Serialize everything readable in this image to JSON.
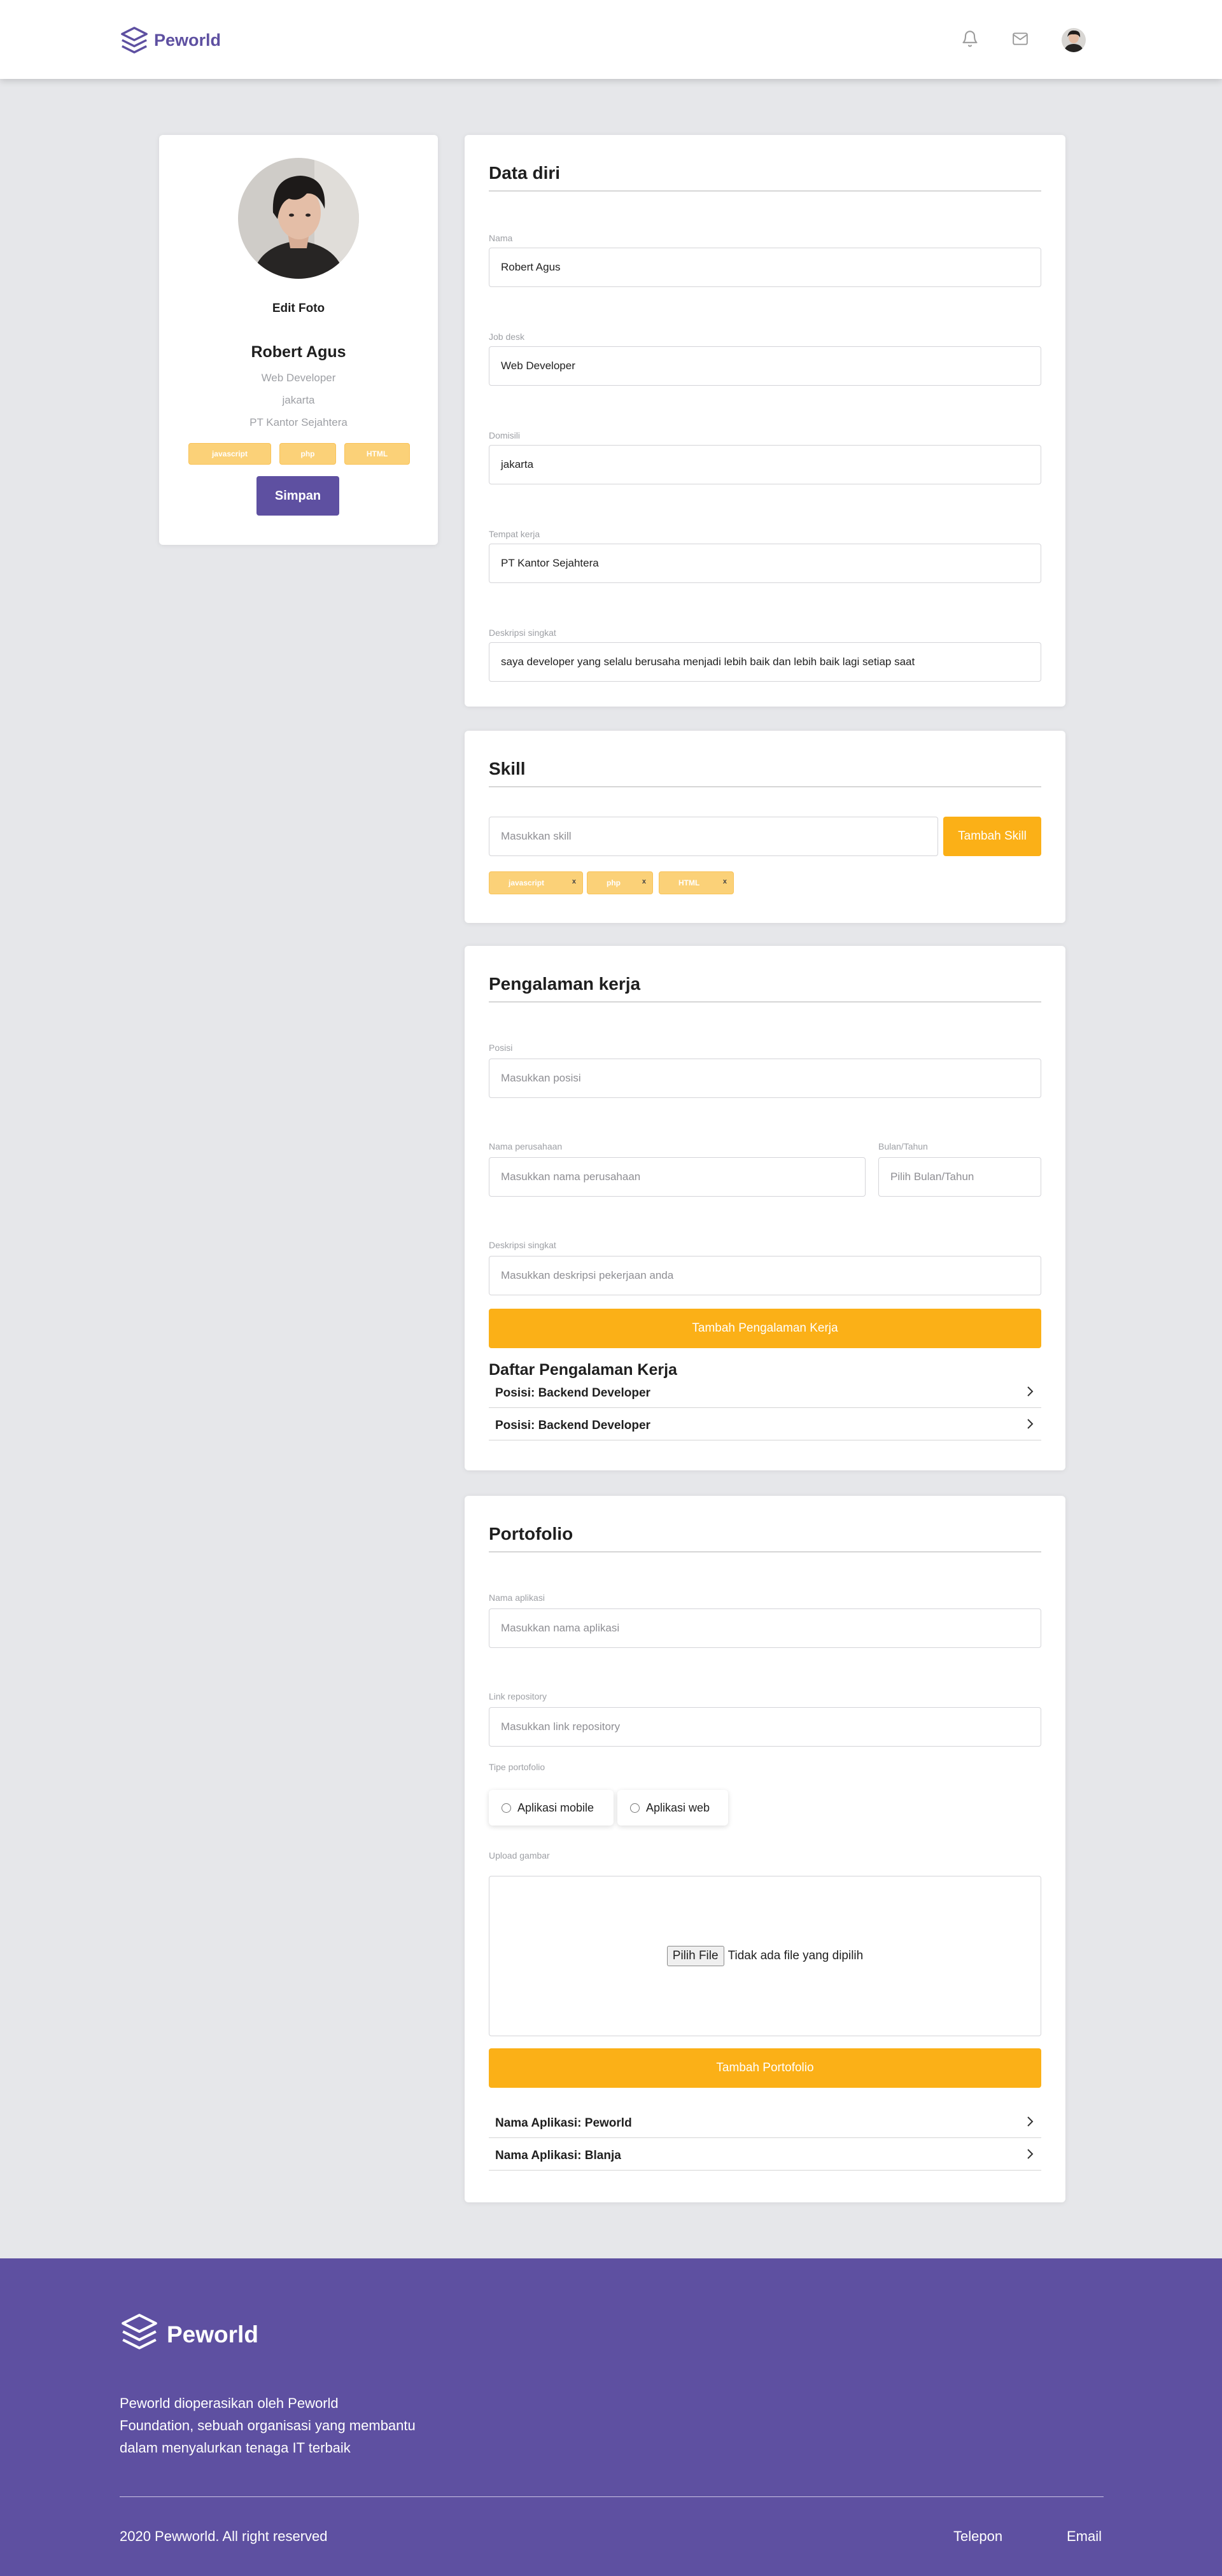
{
  "brand": {
    "name": "Peworld",
    "color": "#5e50a1",
    "accent": "#fbb017"
  },
  "nav": {
    "icons": [
      "bell-icon",
      "mail-icon"
    ],
    "avatar": "user-avatar"
  },
  "profile": {
    "edit_photo": "Edit Foto",
    "name": "Robert Agus",
    "job": "Web Developer",
    "domicile": "jakarta",
    "workplace": "PT Kantor Sejahtera",
    "skills": [
      "javascript",
      "php",
      "HTML"
    ],
    "save_button": "Simpan"
  },
  "data_diri": {
    "title": "Data diri",
    "fields": [
      {
        "label": "Nama",
        "value": "Robert Agus"
      },
      {
        "label": "Job desk",
        "value": "Web Developer"
      },
      {
        "label": "Domisili",
        "value": "jakarta"
      },
      {
        "label": "Tempat kerja",
        "value": "PT Kantor Sejahtera"
      },
      {
        "label": "Deskripsi singkat",
        "value": "saya developer yang selalu berusaha menjadi lebih baik dan lebih baik lagi setiap saat"
      }
    ]
  },
  "skill": {
    "title": "Skill",
    "placeholder": "Masukkan skill",
    "add_button": "Tambah Skill",
    "chips": [
      "javascript",
      "php",
      "HTML"
    ],
    "remove_symbol": "x"
  },
  "experience": {
    "title": "Pengalaman kerja",
    "position_label": "Posisi",
    "position_placeholder": "Masukkan posisi",
    "company_label": "Nama perusahaan",
    "company_placeholder": "Masukkan nama perusahaan",
    "date_label": "Bulan/Tahun",
    "date_placeholder": "Pilih Bulan/Tahun",
    "desc_label": "Deskripsi singkat",
    "desc_placeholder": "Masukkan deskripsi pekerjaan anda",
    "add_button": "Tambah Pengalaman Kerja",
    "list_title": "Daftar Pengalaman Kerja",
    "items": [
      "Posisi: Backend Developer",
      "Posisi: Backend Developer"
    ]
  },
  "portfolio": {
    "title": "Portofolio",
    "app_label": "Nama aplikasi",
    "app_placeholder": "Masukkan nama aplikasi",
    "repo_label": "Link repository",
    "repo_placeholder": "Masukkan link repository",
    "type_label": "Tipe portofolio",
    "types": [
      "Aplikasi mobile",
      "Aplikasi web"
    ],
    "upload_label": "Upload gambar",
    "file_button": "Pilih File",
    "file_status": "Tidak ada file yang dipilih",
    "add_button": "Tambah Portofolio",
    "items": [
      "Nama Aplikasi: Peworld",
      "Nama Aplikasi: Blanja"
    ]
  },
  "footer": {
    "brand": "Peworld",
    "description_lines": [
      "Peworld dioperasikan oleh Peworld",
      "Foundation, sebuah organisasi yang membantu",
      "dalam menyalurkan tenaga IT terbaik"
    ],
    "copyright": "2020 Pewworld. All right reserved",
    "links": [
      "Telepon",
      "Email"
    ]
  }
}
